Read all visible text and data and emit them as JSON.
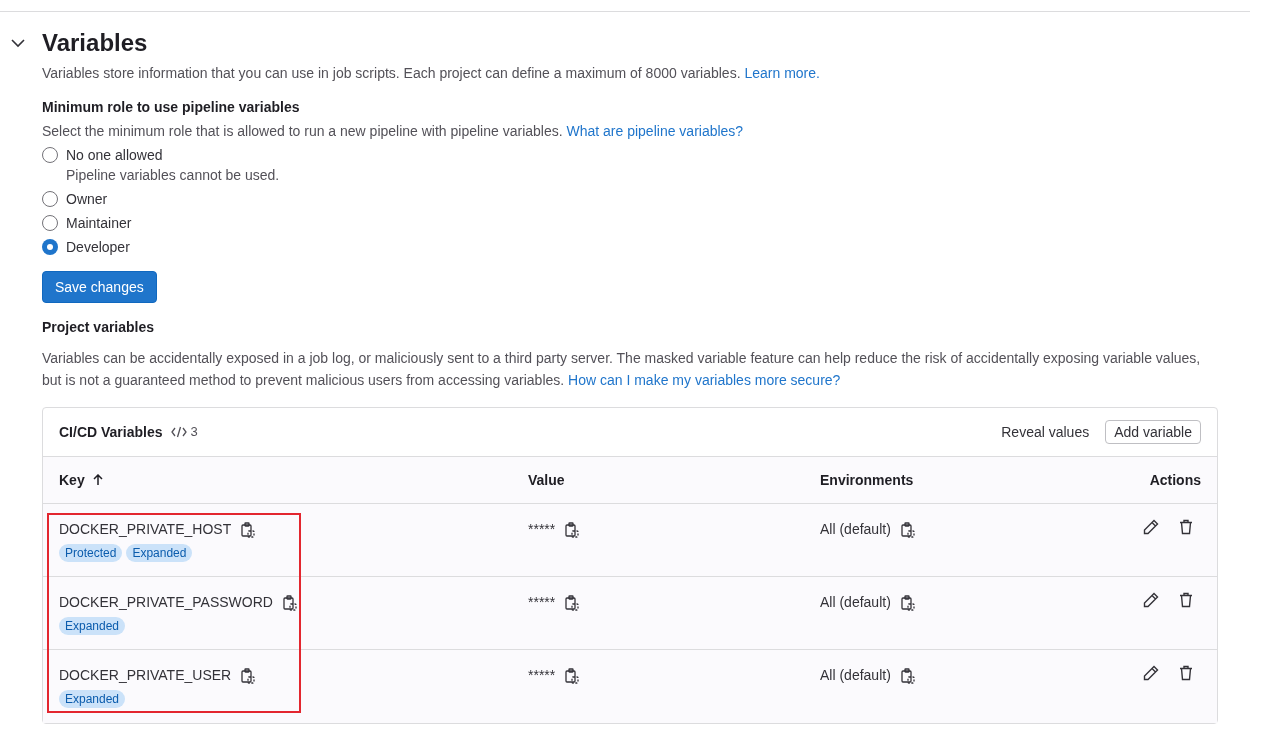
{
  "section": {
    "title": "Variables",
    "expanded": true,
    "description": "Variables store information that you can use in job scripts. Each project can define a maximum of 8000 variables.",
    "link": "Learn more."
  },
  "min_role": {
    "heading": "Minimum role to use pipeline variables",
    "description": "Select the minimum role that is allowed to run a new pipeline with pipeline variables.",
    "link": "What are pipeline variables?",
    "options": [
      {
        "label": "No one allowed",
        "help": "Pipeline variables cannot be used.",
        "selected": false
      },
      {
        "label": "Owner",
        "selected": false
      },
      {
        "label": "Maintainer",
        "selected": false
      },
      {
        "label": "Developer",
        "selected": true
      }
    ],
    "button": "Save changes"
  },
  "project_variables": {
    "heading": "Project variables",
    "description": "Variables can be accidentally exposed in a job log, or maliciously sent to a third party server. The masked variable feature can help reduce the risk of accidentally exposing variable values, but is not a guaranteed method to prevent malicious users from accessing variables.",
    "link": "How can I make my variables more secure?"
  },
  "table": {
    "title": "CI/CD Variables",
    "count": "3",
    "reveal_button": "Reveal values",
    "add_button": "Add variable",
    "columns": [
      "Key",
      "Value",
      "Environments",
      "Actions"
    ],
    "rows": [
      {
        "key": "DOCKER_PRIVATE_HOST",
        "badges": [
          "Protected",
          "Expanded"
        ],
        "value": "*****",
        "environment": "All (default)"
      },
      {
        "key": "DOCKER_PRIVATE_PASSWORD",
        "badges": [
          "Expanded"
        ],
        "value": "*****",
        "environment": "All (default)"
      },
      {
        "key": "DOCKER_PRIVATE_USER",
        "badges": [
          "Expanded"
        ],
        "value": "*****",
        "environment": "All (default)"
      }
    ]
  }
}
